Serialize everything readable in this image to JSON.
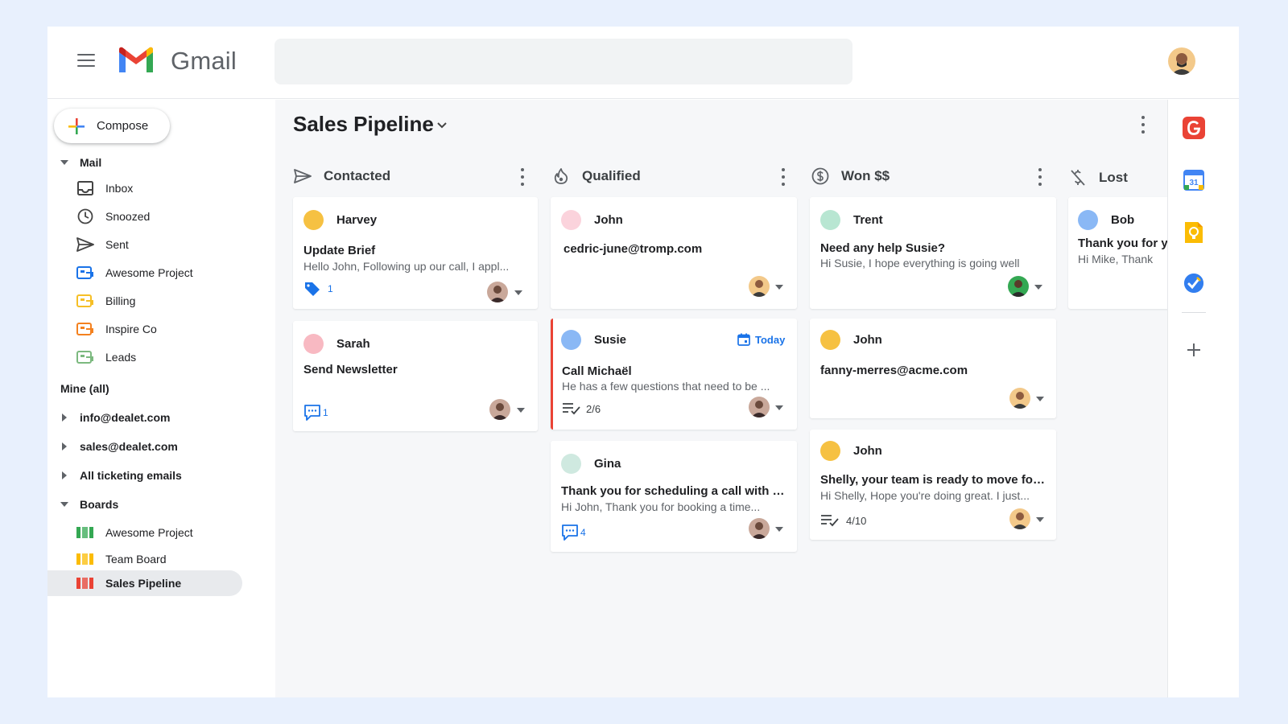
{
  "header": {
    "app_name": "Gmail",
    "search_placeholder": ""
  },
  "sidebar": {
    "compose_label": "Compose",
    "mail_section": "Mail",
    "mail_items": [
      {
        "label": "Inbox",
        "icon": "inbox-icon"
      },
      {
        "label": "Snoozed",
        "icon": "clock-icon"
      },
      {
        "label": "Sent",
        "icon": "send-icon"
      },
      {
        "label": "Awesome Project",
        "icon": "label-icon",
        "color": "#1a73e8"
      },
      {
        "label": "Billing",
        "icon": "label-icon",
        "color": "#f6bf26"
      },
      {
        "label": "Inspire Co",
        "icon": "label-icon",
        "color": "#f4811f"
      },
      {
        "label": "Leads",
        "icon": "label-icon",
        "color": "#7cb97f"
      }
    ],
    "mine_all": "Mine (all)",
    "shared_inboxes": [
      "info@dealet.com",
      "sales@dealet.com",
      "All ticketing emails"
    ],
    "boards_section": "Boards",
    "boards": [
      {
        "label": "Awesome Project",
        "color": "#34a853"
      },
      {
        "label": "Team Board",
        "color": "#fbbc04"
      },
      {
        "label": "Sales Pipeline",
        "color": "#ea4335",
        "active": true
      }
    ]
  },
  "board": {
    "title": "Sales Pipeline",
    "columns": [
      {
        "label": "Contacted",
        "icon": "send-icon"
      },
      {
        "label": "Qualified",
        "icon": "fire-icon"
      },
      {
        "label": "Won $$",
        "icon": "dollar-icon"
      },
      {
        "label": "Lost",
        "icon": "money-off-icon"
      }
    ],
    "cards": {
      "c1": {
        "name": "Harvey",
        "color": "#f6c142",
        "subject": "Update Brief",
        "snippet": "Hello John, Following up our call, I appl...",
        "meta": "1"
      },
      "c2": {
        "name": "Sarah",
        "color": "#f8b9c2",
        "subject": "Send Newsletter",
        "meta": "1"
      },
      "q1": {
        "name": "John",
        "color": "#fbd3dc",
        "subject": "cedric-june@tromp.com"
      },
      "q2": {
        "name": "Susie",
        "color": "#8ab8f5",
        "due": "Today",
        "subject": "Call Michaël",
        "snippet": "He has a few questions that need to be ...",
        "meta": "2/6"
      },
      "q3": {
        "name": "Gina",
        "color": "#cfe9e0",
        "subject": "Thank you for scheduling a call with m...",
        "snippet": "Hi John, Thank you for booking a time...",
        "meta": "4"
      },
      "w1": {
        "name": "Trent",
        "color": "#b8e6d2",
        "subject": "Need any help Susie?",
        "snippet": "Hi Susie, I hope everything is going well"
      },
      "w2": {
        "name": "John",
        "color": "#f6c142",
        "subject": "fanny-merres@acme.com"
      },
      "w3": {
        "name": "John",
        "color": "#f6c142",
        "subject": "Shelly, your team is ready to move forw...",
        "snippet": "Hi Shelly, Hope you're doing great. I just...",
        "meta": "4/10"
      },
      "l1": {
        "name": "Bob",
        "color": "#8ab8f5",
        "subject": "Thank you for y",
        "snippet": "Hi Mike, Thank"
      }
    }
  }
}
